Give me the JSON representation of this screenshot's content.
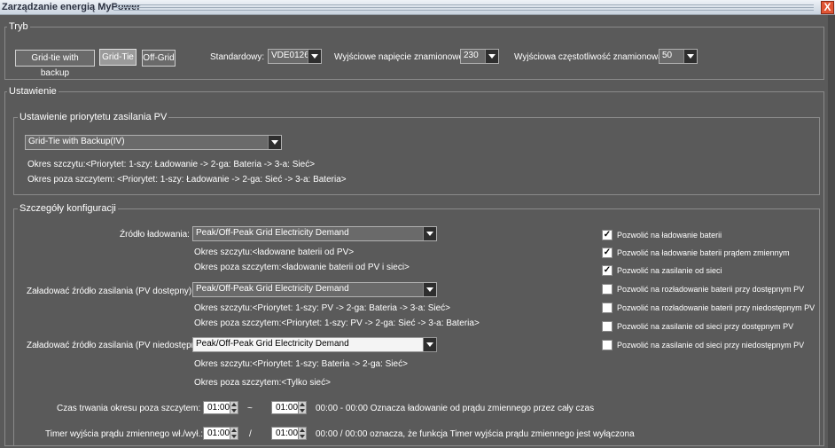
{
  "window": {
    "title": "Zarządzanie energią MyPower",
    "close_glyph": "X"
  },
  "tryb": {
    "legend": "Tryb",
    "buttons": [
      "Grid-tie with backup",
      "Grid-Tie",
      "Off-Grid"
    ],
    "standard_label": "Standardowy:",
    "standard_value": "VDE0126",
    "voltage_label": "Wyjściowe napięcie znamionowe :",
    "voltage_value": "230",
    "freq_label": "Wyjściowa częstotliwość znamionowa:",
    "freq_value": "50"
  },
  "ustawienie": {
    "legend": "Ustawienie",
    "priorytet": {
      "legend": "Ustawienie priorytetu zasilania PV",
      "select": "Grid-Tie with Backup(IV)",
      "peak": "Okres szczytu:<Priorytet: 1-szy: Ładowanie -> 2-ga: Bateria -> 3-a: Sieć>",
      "offpeak": "Okres poza szczytem: <Priorytet: 1-szy: Ładowanie -> 2-ga: Sieć -> 3-a: Bateria>"
    },
    "szczegoly": {
      "legend": "Szczegóły konfiguracji",
      "zrodlo_label": "Źródło ładowania:",
      "zrodlo_value": "Peak/Off-Peak Grid Electricity Demand",
      "zrodlo_peak": "Okres szczytu:<ładowane baterii od PV>",
      "zrodlo_offpeak": "Okres poza szczytem:<ładowanie baterii od PV i sieci>",
      "pvdost_label": "Załadować źródło zasilania (PV dostępny):",
      "pvdost_value": "Peak/Off-Peak Grid Electricity Demand",
      "pvdost_peak": "Okres szczytu:<Priorytet: 1-szy: PV -> 2-ga: Bateria -> 3-a: Sieć>",
      "pvdost_offpeak": "Okres poza szczytem:<Priorytet: 1-szy: PV -> 2-ga: Sieć -> 3-a: Bateria>",
      "pvniedost_label": "Załadować źródło zasilania (PV niedostępny):",
      "pvniedost_value": "Peak/Off-Peak Grid Electricity Demand",
      "pvniedost_peak": "Okres szczytu:<Priorytet: 1-szy: Bateria -> 2-ga: Sieć>",
      "pvniedost_offpeak": "Okres poza szczytem:<Tylko sieć>",
      "czas_label": "Czas trwania okresu poza szczytem:",
      "czas_from": "01:00",
      "czas_sep": "~",
      "czas_to": "01:00",
      "czas_note": "00:00 - 00:00 Oznacza ładowanie od prądu zmiennego przez cały czas",
      "timer_label": "Timer wyjścia prądu zmiennego wł./wył.:",
      "timer_from": "01:00",
      "timer_sep": "/",
      "timer_to": "01:00",
      "timer_note": "00:00 / 00:00 oznacza, że funkcja Timer wyjścia prądu zmiennego jest wyłączona",
      "checkboxes": [
        {
          "label": "Pozwolić na ładowanie baterii",
          "checked": true
        },
        {
          "label": "Pozwolić na ładowanie baterii prądem zmiennym",
          "checked": true
        },
        {
          "label": "Pozwolić na zasilanie od sieci",
          "checked": true
        },
        {
          "label": "Pozwolić na rozładowanie baterii przy dostępnym PV",
          "checked": false
        },
        {
          "label": "Pozwolić na rozładowanie baterii przy niedostępnym PV",
          "checked": false
        },
        {
          "label": "Pozwolić na zasilanie od sieci przy dostępnym PV",
          "checked": false
        },
        {
          "label": "Pozwolić na zasilanie od sieci przy niedostępnym PV",
          "checked": false
        }
      ],
      "check_glyph": "✓"
    }
  }
}
